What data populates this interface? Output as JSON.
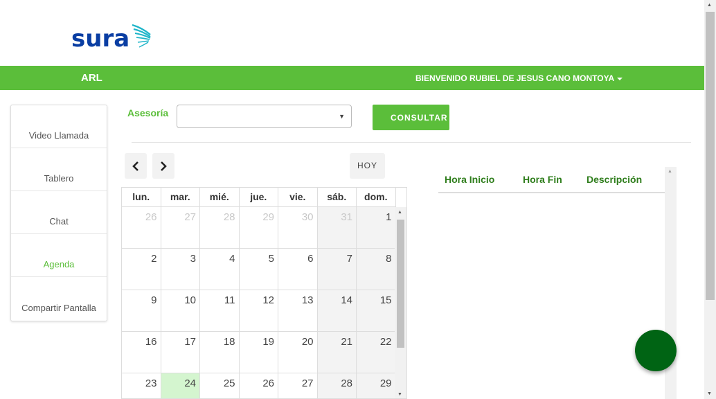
{
  "logo": {
    "text": "sura"
  },
  "topbar": {
    "brand": "ARL",
    "welcome": "BIENVENIDO RUBIEL DE JESUS CANO MONTOYA",
    "accent": "#5bbe3a"
  },
  "sidebar": {
    "items": [
      {
        "label": "Video Llamada",
        "active": false
      },
      {
        "label": "Tablero",
        "active": false
      },
      {
        "label": "Chat",
        "active": false
      },
      {
        "label": "Agenda",
        "active": true
      },
      {
        "label": "Compartir Pantalla",
        "active": false
      }
    ]
  },
  "filter": {
    "label": "Asesoría",
    "select_value": "",
    "button_label": "CONSULTAR C"
  },
  "calendar": {
    "today_label": "HOY",
    "weekdays": [
      "lun.",
      "mar.",
      "mié.",
      "jue.",
      "vie.",
      "sáb.",
      "dom."
    ],
    "weeks": [
      [
        "26",
        "27",
        "28",
        "29",
        "30",
        "31",
        "1"
      ],
      [
        "2",
        "3",
        "4",
        "5",
        "6",
        "7",
        "8"
      ],
      [
        "9",
        "10",
        "11",
        "12",
        "13",
        "14",
        "15"
      ],
      [
        "16",
        "17",
        "18",
        "19",
        "20",
        "21",
        "22"
      ],
      [
        "23",
        "24",
        "25",
        "26",
        "27",
        "28",
        "29"
      ]
    ],
    "other_month_days_first_week": 6,
    "today": "24",
    "today_color": "#d4f5cf"
  },
  "schedule_table": {
    "columns": [
      "Hora Inicio",
      "Hora Fin",
      "Descripción"
    ],
    "rows": []
  },
  "fab": {
    "color": "#006414"
  }
}
